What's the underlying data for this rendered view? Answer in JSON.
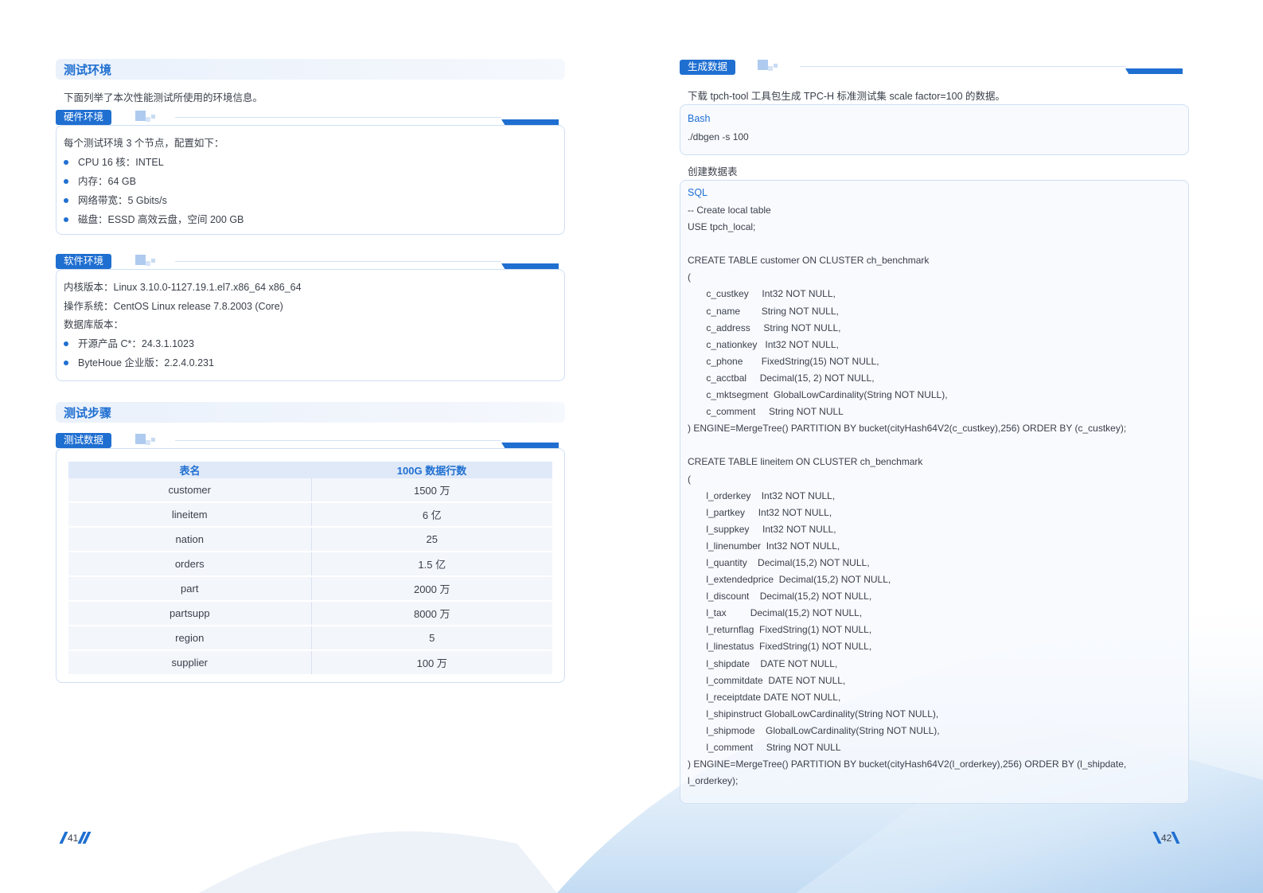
{
  "left": {
    "section1_title": "测试环境",
    "section1_intro": "下面列举了本次性能测试所使用的环境信息。",
    "hardware": {
      "tag": "硬件环境",
      "intro": "每个测试环境 3 个节点，配置如下：",
      "items": [
        "CPU 16 核：INTEL",
        "内存：64 GB",
        "网络带宽：5 Gbits/s",
        "磁盘：ESSD 高效云盘，空间 200 GB"
      ]
    },
    "software": {
      "tag": "软件环境",
      "lines": [
        "内核版本：Linux 3.10.0-1127.19.1.el7.x86_64 x86_64",
        "操作系统：CentOS Linux release 7.8.2003 (Core)",
        "数据库版本："
      ],
      "items": [
        "开源产品 C*：24.3.1.1023",
        "ByteHoue 企业版：2.2.4.0.231"
      ]
    },
    "section2_title": "测试步骤",
    "testdata": {
      "tag": "测试数据",
      "headers": [
        "表名",
        "100G 数据行数"
      ],
      "rows": [
        [
          "customer",
          "1500 万"
        ],
        [
          "lineitem",
          "6 亿"
        ],
        [
          "nation",
          "25"
        ],
        [
          "orders",
          "1.5 亿"
        ],
        [
          "part",
          "2000 万"
        ],
        [
          "partsupp",
          "8000 万"
        ],
        [
          "region",
          "5"
        ],
        [
          "supplier",
          "100 万"
        ]
      ]
    },
    "page_number": "41"
  },
  "right": {
    "gen": {
      "tag": "生成数据",
      "intro": "下载 tpch-tool 工具包生成 TPC-H 标准测试集 scale factor=100 的数据。",
      "lang": "Bash",
      "code": "./dbgen -s 100"
    },
    "create_label": "创建数据表",
    "sql": {
      "lang": "SQL",
      "lines": [
        "-- Create local table",
        "USE tpch_local;",
        "",
        "CREATE TABLE customer ON CLUSTER ch_benchmark",
        "(",
        "       c_custkey     Int32 NOT NULL,",
        "       c_name        String NOT NULL,",
        "       c_address     String NOT NULL,",
        "       c_nationkey   Int32 NOT NULL,",
        "       c_phone       FixedString(15) NOT NULL,",
        "       c_acctbal     Decimal(15, 2) NOT NULL,",
        "       c_mktsegment  GlobalLowCardinality(String NOT NULL),",
        "       c_comment     String NOT NULL",
        ") ENGINE=MergeTree() PARTITION BY bucket(cityHash64V2(c_custkey),256) ORDER BY (c_custkey);",
        "",
        "CREATE TABLE lineitem ON CLUSTER ch_benchmark",
        "(",
        "       l_orderkey    Int32 NOT NULL,",
        "       l_partkey     Int32 NOT NULL,",
        "       l_suppkey     Int32 NOT NULL,",
        "       l_linenumber  Int32 NOT NULL,",
        "       l_quantity    Decimal(15,2) NOT NULL,",
        "       l_extendedprice  Decimal(15,2) NOT NULL,",
        "       l_discount    Decimal(15,2) NOT NULL,",
        "       l_tax         Decimal(15,2) NOT NULL,",
        "       l_returnflag  FixedString(1) NOT NULL,",
        "       l_linestatus  FixedString(1) NOT NULL,",
        "       l_shipdate    DATE NOT NULL,",
        "       l_commitdate  DATE NOT NULL,",
        "       l_receiptdate DATE NOT NULL,",
        "       l_shipinstruct GlobalLowCardinality(String NOT NULL),",
        "       l_shipmode    GlobalLowCardinality(String NOT NULL),",
        "       l_comment     String NOT NULL",
        ") ENGINE=MergeTree() PARTITION BY bucket(cityHash64V2(l_orderkey),256) ORDER BY (l_shipdate,",
        "l_orderkey);"
      ]
    },
    "page_number": "42"
  },
  "colors": {
    "accent": "#1f6fd1",
    "border": "#cfdff3"
  }
}
